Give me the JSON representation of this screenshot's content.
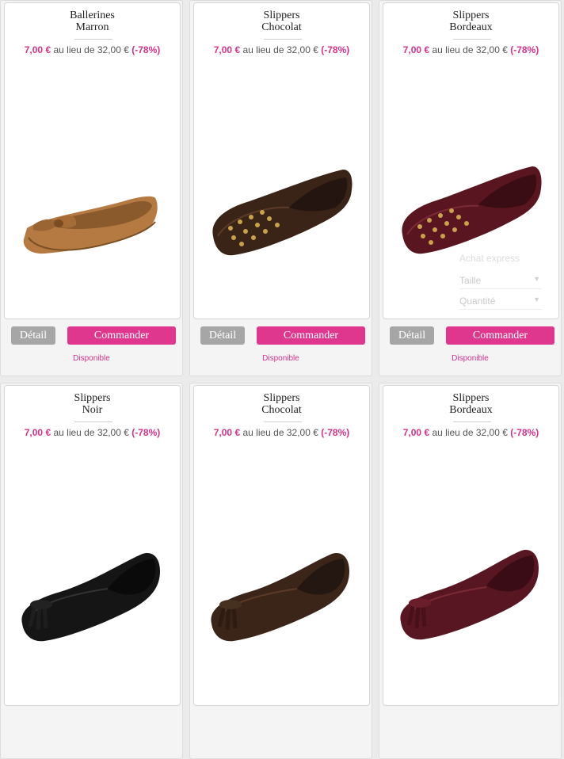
{
  "colors": {
    "accent": "#e0378e",
    "price": "#d5328a",
    "detail_button": "#a6a6a6"
  },
  "products": [
    {
      "name_line1": "Ballerines",
      "name_line2": "Marron",
      "price": "7,00 €",
      "price_text": "au lieu de 32,00 €",
      "discount": "(-78%)",
      "detail_label": "Détail",
      "order_label": "Commander",
      "availability": "Disponible"
    },
    {
      "name_line1": "Slippers",
      "name_line2": "Chocolat",
      "price": "7,00 €",
      "price_text": "au lieu de 32,00 €",
      "discount": "(-78%)",
      "detail_label": "Détail",
      "order_label": "Commander",
      "availability": "Disponible"
    },
    {
      "name_line1": "Slippers",
      "name_line2": "Bordeaux",
      "price": "7,00 €",
      "price_text": "au lieu de 32,00 €",
      "discount": "(-78%)",
      "detail_label": "Détail",
      "order_label": "Commander",
      "availability": "Disponible"
    },
    {
      "name_line1": "Slippers",
      "name_line2": "Noir",
      "price": "7,00 €",
      "price_text": "au lieu de 32,00 €",
      "discount": "(-78%)"
    },
    {
      "name_line1": "Slippers",
      "name_line2": "Chocolat",
      "price": "7,00 €",
      "price_text": "au lieu de 32,00 €",
      "discount": "(-78%)"
    },
    {
      "name_line1": "Slippers",
      "name_line2": "Bordeaux",
      "price": "7,00 €",
      "price_text": "au lieu de 32,00 €",
      "discount": "(-78%)"
    }
  ],
  "quick_order": {
    "title": "Achat express",
    "size_label": "Taille",
    "quantity_label": "Quantité"
  }
}
